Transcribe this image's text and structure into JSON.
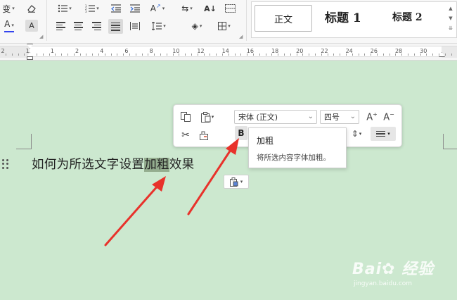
{
  "ribbon": {
    "styles": {
      "normal": "正文",
      "heading1": "标题 1",
      "heading2": "标题 2"
    }
  },
  "ruler": {
    "labels": [
      "2",
      "1",
      "1",
      "2",
      "4",
      "6",
      "8",
      "10",
      "12",
      "14",
      "16",
      "18",
      "20",
      "22",
      "24",
      "26",
      "28",
      "30"
    ]
  },
  "document": {
    "text_before": "如何为所选文字设置",
    "text_selected": "加粗",
    "text_after": "效果"
  },
  "mini_toolbar": {
    "font_name": "宋体 (正文)",
    "font_size": "四号",
    "bold_label": "B"
  },
  "tooltip": {
    "title": "加粗",
    "description": "将所选内容字体加粗。"
  },
  "watermark": {
    "brand": "Bai",
    "suffix": "经验",
    "url": "jingyan.baidu.com"
  },
  "colors": {
    "page_background": "#cce8cf",
    "selection": "#94ad8f",
    "arrow": "#e8322b",
    "font_color_bar": "#3344ee",
    "highlight_bar": "#e02020"
  }
}
